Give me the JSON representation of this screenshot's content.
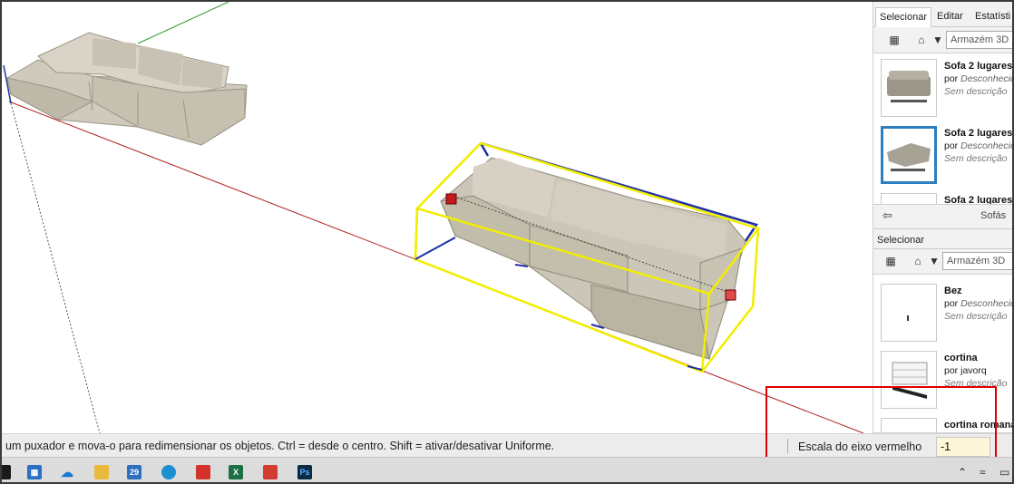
{
  "tray": {
    "tabs": [
      "Selecionar",
      "Editar",
      "Estatísti"
    ],
    "search_placeholder": "Armazém 3D",
    "top_list": [
      {
        "title": "Sofa 2 lugares",
        "by_prefix": "por",
        "author": "Desconhecid",
        "desc": "Sem descrição",
        "selected": false
      },
      {
        "title": "Sofa 2 lugares",
        "by_prefix": "por",
        "author": "Desconhecid",
        "desc": "Sem descrição",
        "selected": true
      },
      {
        "title": "Sofa 2 lugares",
        "by_prefix": "",
        "author": "",
        "desc": "",
        "selected": false
      }
    ],
    "nav_label": "Sofás",
    "section_label": "Selecionar",
    "bottom_list": [
      {
        "title": "Bez",
        "by_prefix": "por",
        "author": "Desconhecid",
        "desc": "Sem descrição"
      },
      {
        "title": "cortina",
        "by_prefix": "por",
        "author": "javorq",
        "desc": "Sem descrição"
      },
      {
        "title": "cortina romana",
        "by_prefix": "",
        "author": "",
        "desc": ""
      }
    ]
  },
  "statusbar": {
    "hint": "um puxador e mova-o para redimensionar os objetos. Ctrl = desde o centro. Shift = ativar/desativar Uniforme.",
    "vcb_label": "Escala do eixo vermelho",
    "vcb_value": "-1"
  },
  "taskbar": {
    "calendar_day": "29",
    "apps": [
      "file-explorer-icon",
      "store-icon",
      "onedrive-icon",
      "folder-icon",
      "calendar-icon",
      "edge-icon",
      "acrobat-icon",
      "excel-icon",
      "sketchup-icon",
      "photoshop-icon"
    ],
    "photoshop_label": "Ps"
  },
  "colors": {
    "red_axis": "#b22222",
    "green_axis": "#2e9e2e",
    "blue_axis": "#1f2fa8",
    "selection_box": "#f2ee00",
    "highlight": "#e00000",
    "vcb_bg": "#fdf6d8",
    "selected_thumb": "#2c7fc1"
  }
}
